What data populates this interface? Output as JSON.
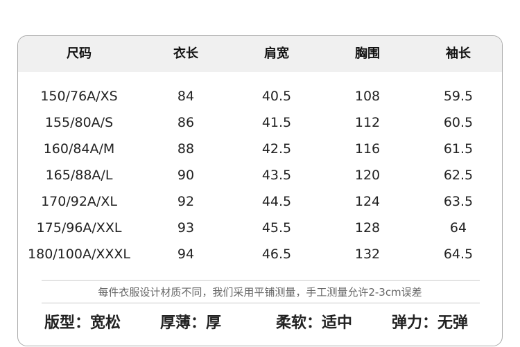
{
  "table": {
    "headers": [
      "尺码",
      "衣长",
      "肩宽",
      "胸围",
      "袖长"
    ],
    "rows": [
      [
        "150/76A/XS",
        "84",
        "40.5",
        "108",
        "59.5"
      ],
      [
        "155/80A/S",
        "86",
        "41.5",
        "112",
        "60.5"
      ],
      [
        "160/84A/M",
        "88",
        "42.5",
        "116",
        "61.5"
      ],
      [
        "165/88A/L",
        "90",
        "43.5",
        "120",
        "62.5"
      ],
      [
        "170/92A/XL",
        "92",
        "44.5",
        "124",
        "63.5"
      ],
      [
        "175/96A/XXL",
        "93",
        "45.5",
        "128",
        "64"
      ],
      [
        "180/100A/XXXL",
        "94",
        "46.5",
        "132",
        "64.5"
      ]
    ]
  },
  "note": "每件衣服设计材质不同，我们采用平铺测量，手工测量允许2-3cm误差",
  "footer": {
    "fit": "版型：宽松",
    "thickness": "厚薄：厚",
    "softness": "柔软：适中",
    "elasticity": "弹力：无弹"
  }
}
